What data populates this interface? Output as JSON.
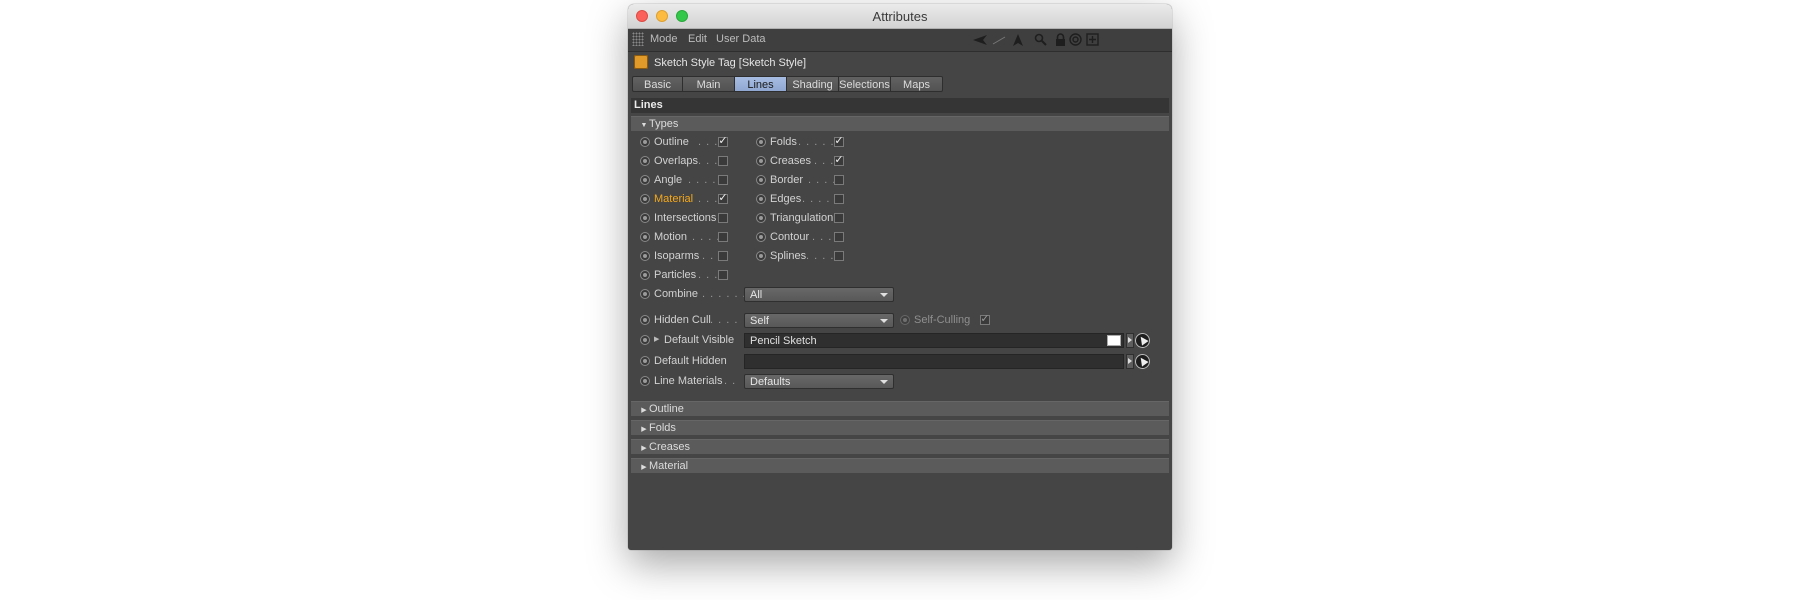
{
  "window": {
    "title": "Attributes"
  },
  "menubar": {
    "items": [
      "Mode",
      "Edit",
      "User Data"
    ],
    "toolbar_icons": [
      "back-arrow-icon",
      "forward-arrow-icon",
      "up-arrow-icon",
      "search-icon",
      "lock-icon",
      "target-icon",
      "new-panel-icon"
    ]
  },
  "object": {
    "title": "Sketch Style Tag [Sketch Style]",
    "icon": "sketch-tag-icon"
  },
  "tabs": [
    {
      "label": "Basic",
      "active": false
    },
    {
      "label": "Main",
      "active": false
    },
    {
      "label": "Lines",
      "active": true
    },
    {
      "label": "Shading",
      "active": false
    },
    {
      "label": "Selections",
      "active": false
    },
    {
      "label": "Maps",
      "active": false
    }
  ],
  "section": {
    "title": "Lines"
  },
  "types_group": {
    "label": "Types",
    "expanded": true
  },
  "types_left": [
    {
      "label": "Outline",
      "dots": ". . . .",
      "checked": true,
      "highlight": false
    },
    {
      "label": "Overlaps",
      "dots": ". . .",
      "checked": false,
      "highlight": false
    },
    {
      "label": "Angle",
      "dots": ". . . . .",
      "checked": false,
      "highlight": false
    },
    {
      "label": "Material",
      "dots": ". . .",
      "checked": true,
      "highlight": true
    },
    {
      "label": "Intersections",
      "dots": "",
      "checked": false,
      "highlight": false
    },
    {
      "label": "Motion",
      "dots": ". . . .",
      "checked": false,
      "highlight": false
    },
    {
      "label": "Isoparms",
      "dots": ". .",
      "checked": false,
      "highlight": false
    },
    {
      "label": "Particles",
      "dots": ". . .",
      "checked": false,
      "highlight": false
    }
  ],
  "types_right": [
    {
      "label": "Folds",
      "dots": ". . . . . .",
      "checked": true
    },
    {
      "label": "Creases",
      "dots": ". . .",
      "checked": true
    },
    {
      "label": "Border",
      "dots": ". . . .",
      "checked": false
    },
    {
      "label": "Edges",
      "dots": ". . . . .",
      "checked": false
    },
    {
      "label": "Triangulation",
      "dots": "",
      "checked": false
    },
    {
      "label": "Contour",
      "dots": ". . .",
      "checked": false
    },
    {
      "label": "Splines",
      "dots": ". . . .",
      "checked": false
    }
  ],
  "combine": {
    "label": "Combine",
    "dots": ". . . . . .",
    "value": "All"
  },
  "hidden_cull": {
    "label": "Hidden Cull",
    "dots": ". . . .",
    "value": "Self",
    "self_culling_label": "Self-Culling",
    "self_culling_checked": true
  },
  "default_visible": {
    "label": "Default Visible",
    "value": "Pencil Sketch"
  },
  "default_hidden": {
    "label": "Default Hidden",
    "value": ""
  },
  "line_materials": {
    "label": "Line Materials",
    "dots": ". .",
    "value": "Defaults"
  },
  "collapsed_groups": [
    "Outline",
    "Folds",
    "Creases",
    "Material"
  ],
  "check_glyph": "✓"
}
